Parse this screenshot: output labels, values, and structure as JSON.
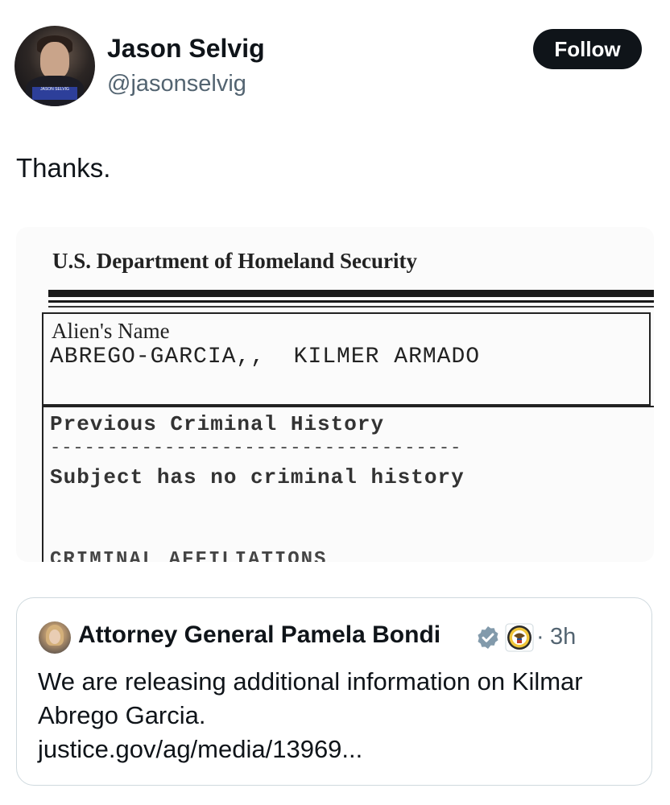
{
  "author": {
    "name": "Jason Selvig",
    "handle": "@jasonselvig",
    "avatar_banner": "JASON SELVIG"
  },
  "follow_button": {
    "label": "Follow"
  },
  "tweet": {
    "text": "Thanks."
  },
  "document": {
    "header": "U.S. Department of Homeland Security",
    "name_label": "Alien's Name",
    "name_value": "ABREGO-GARCIA,,  KILMER ARMADO",
    "history_label": "Previous Criminal History",
    "separator": "------------------------------------",
    "history_value": "Subject has no criminal history",
    "next_section": "CRIMINAL AFFILIATIONS"
  },
  "quoted_tweet": {
    "author": "Attorney General Pamela Bondi",
    "dot": "·",
    "time": "3h",
    "text": "We are releasing additional information on Kilmar Abrego Garcia.",
    "link": "justice.gov/ag/media/13969..."
  },
  "icons": {
    "verified": "verified-badge-icon",
    "seal": "doj-seal-icon"
  },
  "colors": {
    "follow_bg": "#0f1419",
    "secondary_text": "#536471",
    "verified_gray": "#829aab"
  }
}
